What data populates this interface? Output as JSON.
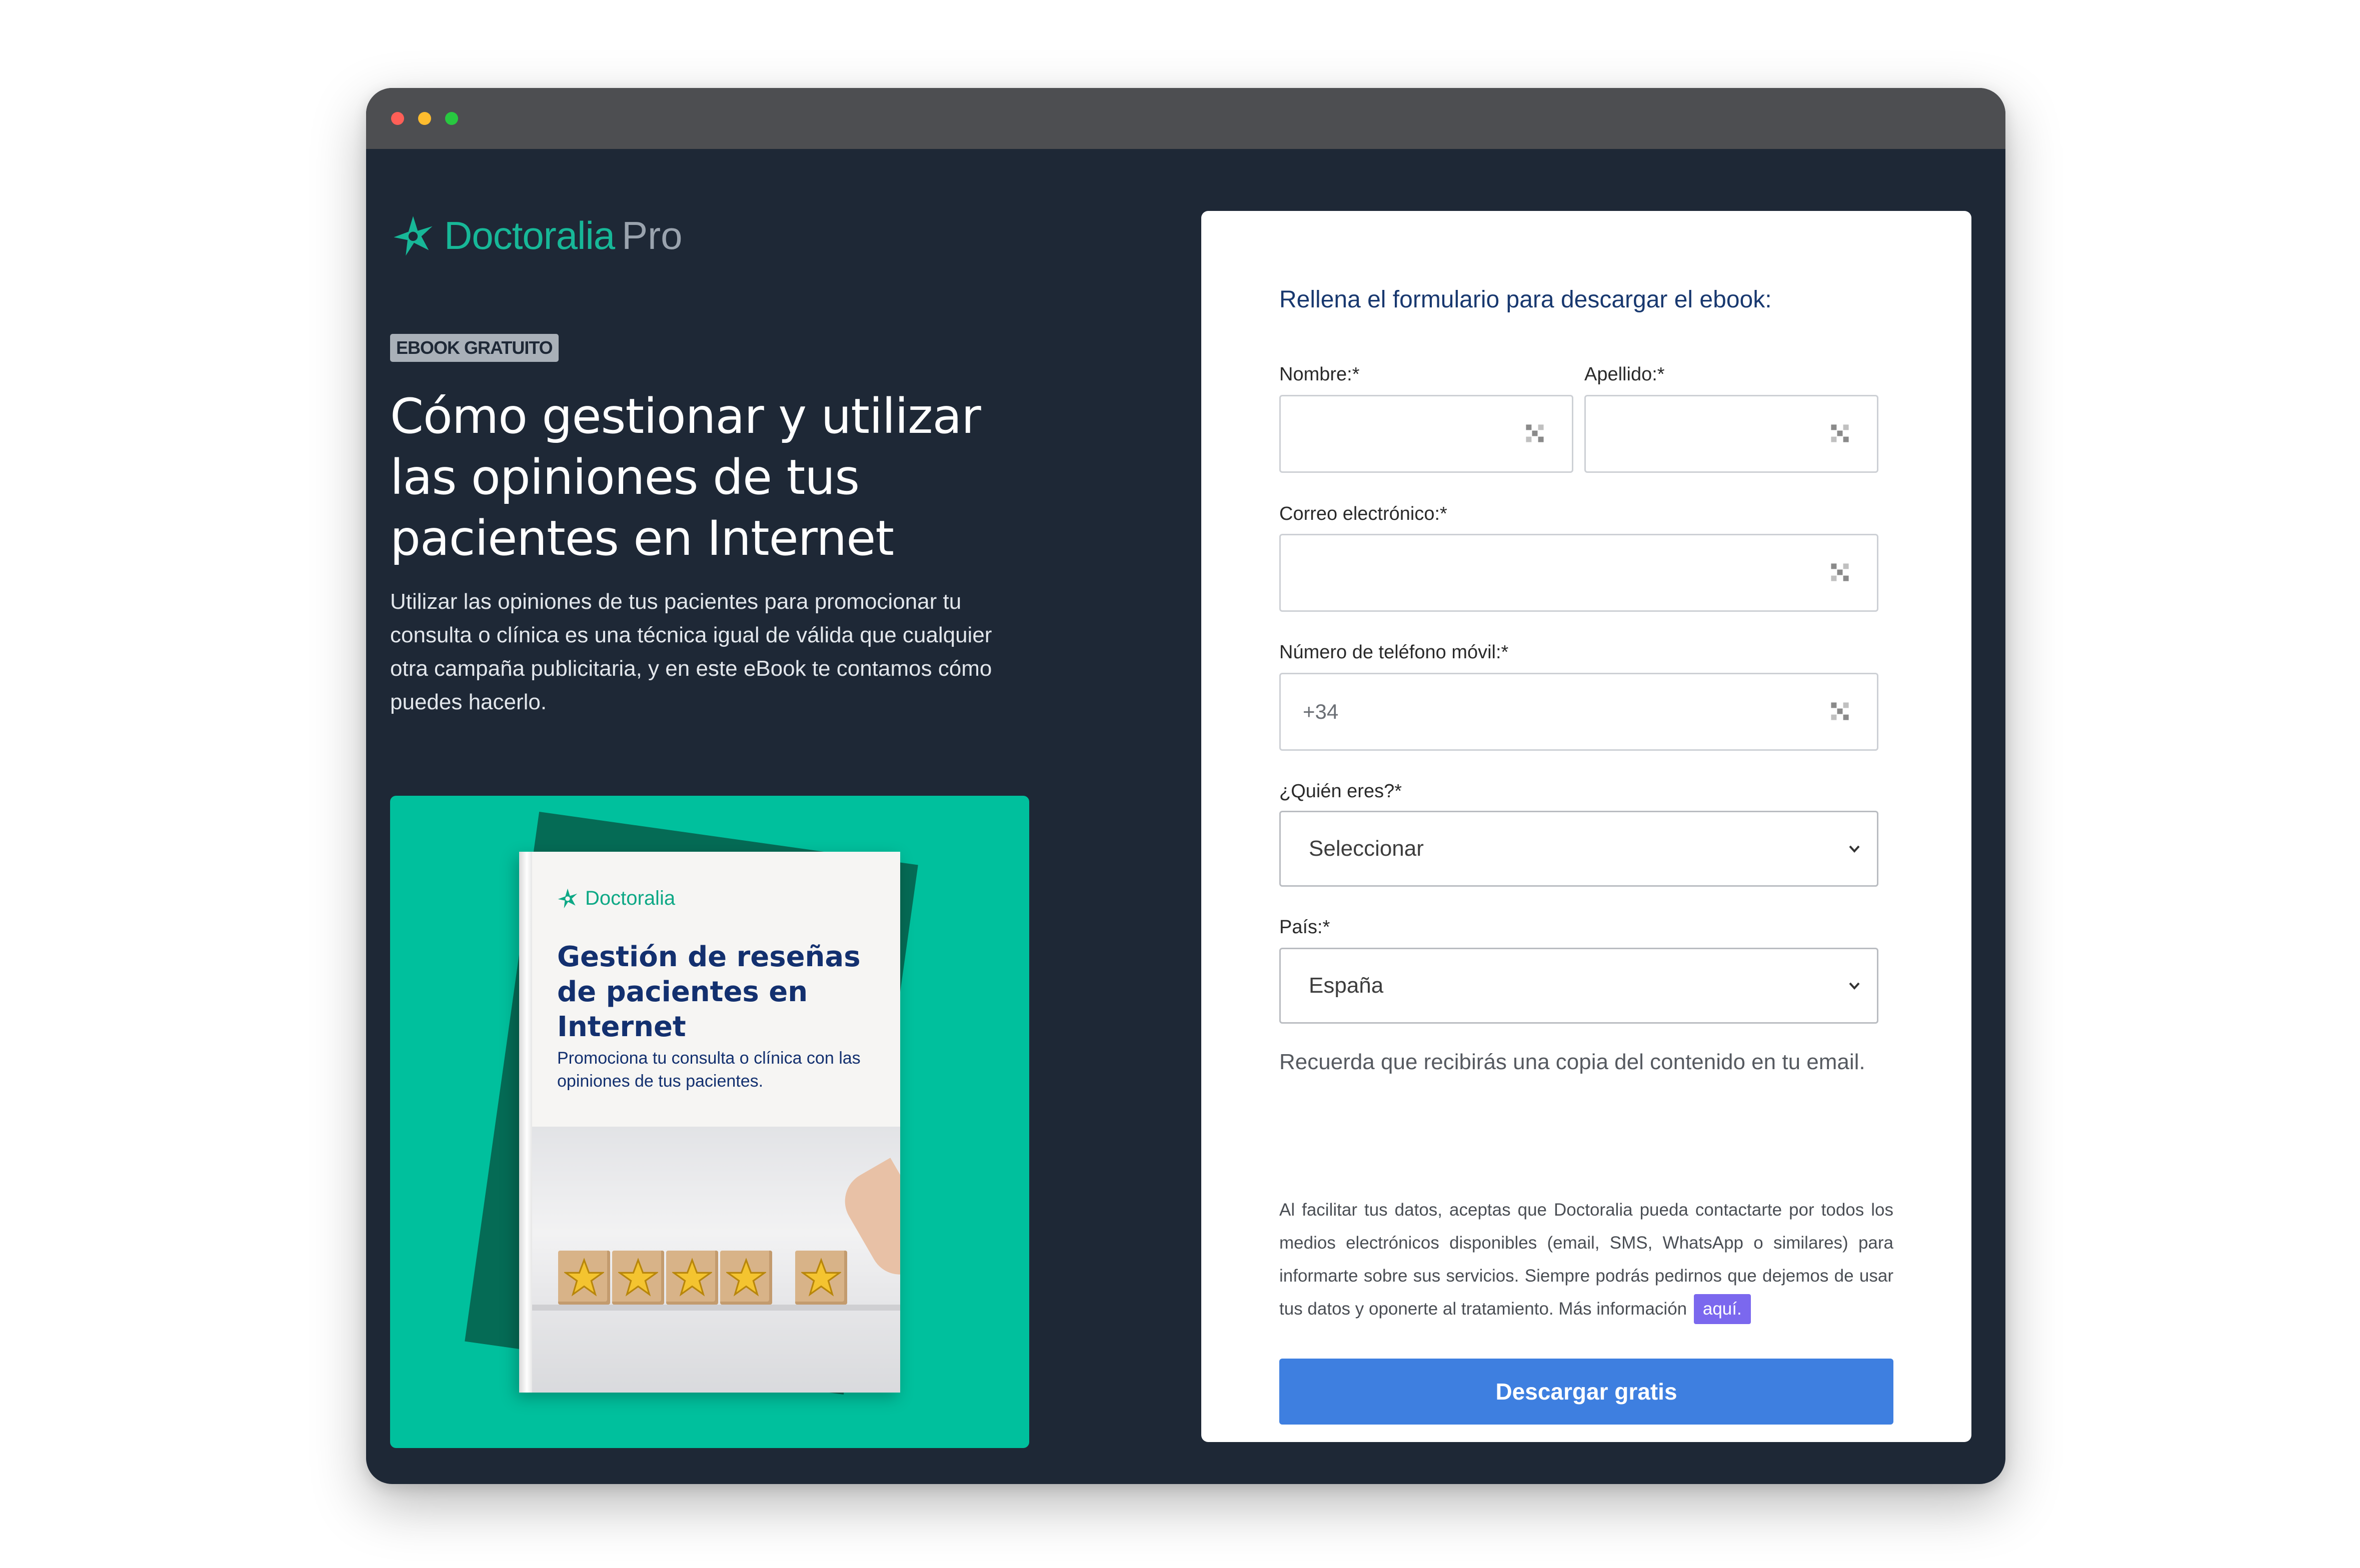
{
  "window": {
    "controls": [
      "close",
      "minimize",
      "maximize"
    ]
  },
  "brand": {
    "name": "Doctoralia",
    "suffix": "Pro",
    "logo_icon": "doctoralia-star-icon",
    "color": "#17b898"
  },
  "hero": {
    "badge": "EBOOK GRATUITO",
    "title": "Cómo gestionar y utilizar las opiniones de tus pacientes en Internet",
    "description": "Utilizar las opiniones de tus pacientes para promocionar tu consulta o clínica es una técnica igual de válida que cualquier otra campaña publicitaria, y en este eBook te contamos cómo puedes hacerlo."
  },
  "ebook_cover": {
    "brand": "Doctoralia",
    "title": "Gestión de reseñas de pacientes en Internet",
    "subtitle": "Promociona tu consulta o clínica con las opiniones de tus pacientes.",
    "rating_stars": 5,
    "accent": "#00c09d"
  },
  "form": {
    "heading": "Rellena el formulario para descargar el ebook:",
    "fields": {
      "first_name": {
        "label": "Nombre:*",
        "value": "",
        "placeholder": ""
      },
      "last_name": {
        "label": "Apellido:*",
        "value": "",
        "placeholder": ""
      },
      "email": {
        "label": "Correo electrónico:*",
        "value": "",
        "placeholder": ""
      },
      "phone": {
        "label": "Número de teléfono móvil:*",
        "value": "",
        "placeholder": "+34"
      },
      "role": {
        "label": "¿Quién eres?*",
        "selected": "Seleccionar"
      },
      "country": {
        "label": "País:*",
        "selected": "España"
      }
    },
    "field_icon": "autofill-key-icon",
    "reminder": "Recuerda que recibirás una copia del contenido en tu email.",
    "legal": "Al facilitar tus datos, aceptas que Doctoralia pueda contactarte por todos los medios electrónicos disponibles (email, SMS, WhatsApp o similares) para informarte sobre sus servicios. Siempre podrás pedirnos que dejemos de usar tus datos y oponerte al tratamiento. Más información",
    "legal_link": "aquí.",
    "submit": "Descargar gratis",
    "submit_color": "#3e7fe0"
  }
}
